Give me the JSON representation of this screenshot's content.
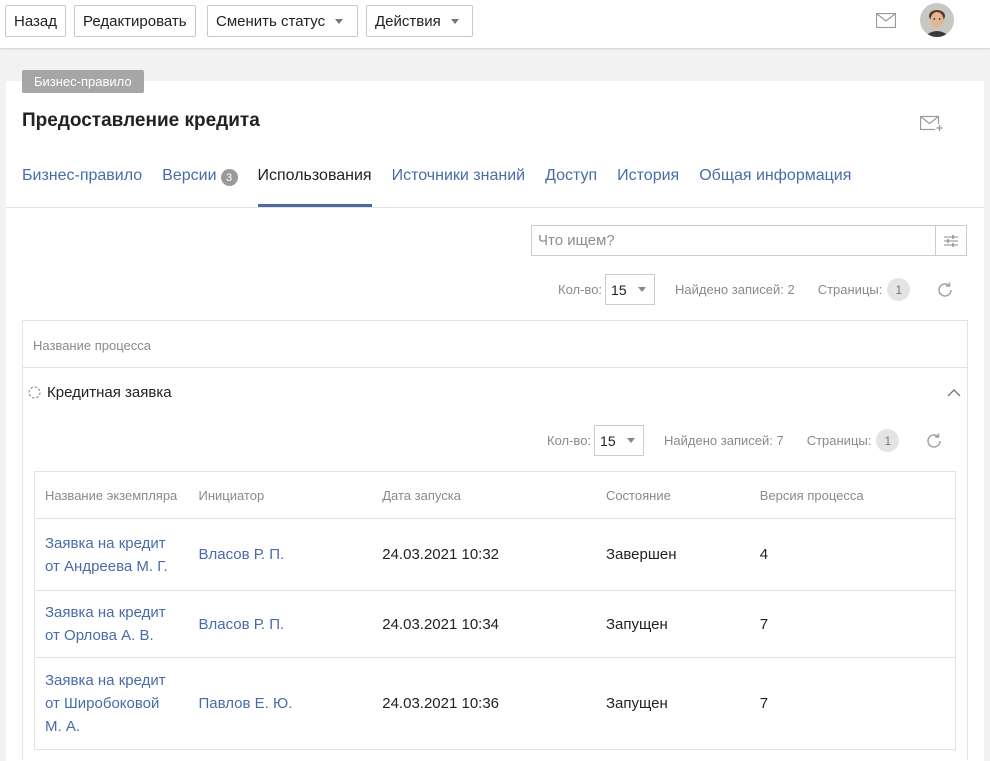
{
  "toolbar": {
    "back_label": "Назад",
    "edit_label": "Редактировать",
    "change_status_label": "Сменить статус",
    "actions_label": "Действия"
  },
  "card": {
    "type_badge": "Бизнес-правило",
    "title": "Предоставление кредита"
  },
  "tabs": [
    {
      "label": "Бизнес-правило",
      "active": false
    },
    {
      "label": "Версии",
      "badge": "3",
      "active": false
    },
    {
      "label": "Использования",
      "active": true
    },
    {
      "label": "Источники знаний",
      "active": false
    },
    {
      "label": "Доступ",
      "active": false
    },
    {
      "label": "История",
      "active": false
    },
    {
      "label": "Общая информация",
      "active": false
    }
  ],
  "search": {
    "placeholder": "Что ищем?"
  },
  "outer_pager": {
    "count_label": "Кол-во:",
    "count_value": "15",
    "found_text": "Найдено записей: 2",
    "pages_label": "Страницы:",
    "page": "1"
  },
  "outer_table": {
    "header": "Название процесса"
  },
  "group": {
    "title": "Кредитная заявка"
  },
  "inner_pager": {
    "count_label": "Кол-во:",
    "count_value": "15",
    "found_text": "Найдено записей: 7",
    "pages_label": "Страницы:",
    "page": "1"
  },
  "inner_table": {
    "columns": [
      "Название экземпляра",
      "Инициатор",
      "Дата запуска",
      "Состояние",
      "Версия процесса"
    ],
    "rows": [
      {
        "name": "Заявка на кредит от Андреева М. Г.",
        "initiator": "Власов Р. П.",
        "date": "24.03.2021 10:32",
        "state": "Завершен",
        "version": "4"
      },
      {
        "name": "Заявка на кредит от Орлова А. В.",
        "initiator": "Власов Р. П.",
        "date": "24.03.2021 10:34",
        "state": "Запущен",
        "version": "7"
      },
      {
        "name": "Заявка на кредит от Широбоковой М. А.",
        "initiator": "Павлов Е. Ю.",
        "date": "24.03.2021 10:36",
        "state": "Запущен",
        "version": "7"
      }
    ]
  },
  "colors": {
    "accent": "#4a6ba8",
    "badge": "#a6a6a6",
    "border": "#e3e3e3"
  },
  "icons": {
    "mail": "mail-icon",
    "avatar": "avatar",
    "mail_plus": "mail-plus-icon",
    "filter": "filter-settings-icon",
    "refresh": "refresh-icon",
    "process": "process-dashed-circle-icon",
    "collapse": "chevron-up-icon"
  }
}
